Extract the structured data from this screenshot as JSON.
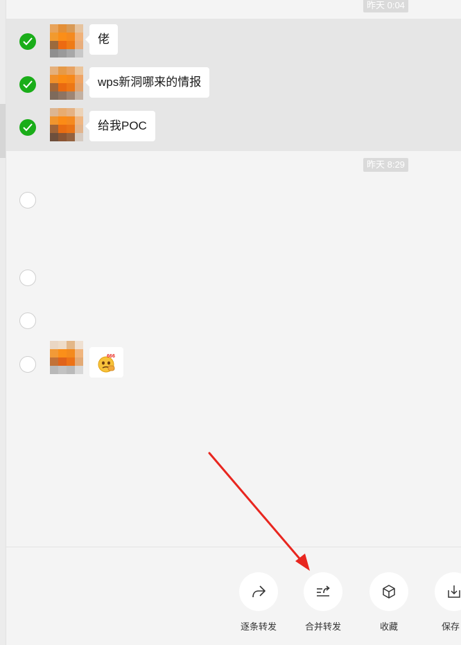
{
  "timestamps": [
    "昨天 0:04",
    "昨天 8:29"
  ],
  "messages": [
    {
      "text": "佬",
      "selected": true
    },
    {
      "text": "wps新洞哪来的情报",
      "selected": true
    },
    {
      "text": "给我POC",
      "selected": true
    },
    {
      "text": "",
      "selected": false
    },
    {
      "text": "",
      "selected": false
    },
    {
      "text": "",
      "selected": false
    },
    {
      "sticker_text": "666",
      "sticker_icon": "emoji-666-sticker",
      "selected": false
    }
  ],
  "actions": [
    {
      "label": "逐条转发",
      "icon": "forward-icon"
    },
    {
      "label": "合并转发",
      "icon": "merge-forward-icon"
    },
    {
      "label": "收藏",
      "icon": "favorite-cube-icon"
    },
    {
      "label": "保存",
      "icon": "save-download-icon"
    }
  ],
  "colors": {
    "accent_green": "#1aad19",
    "annotation_red": "#e8261f",
    "background": "#f4f4f4",
    "selected_row": "#e6e6e6"
  }
}
